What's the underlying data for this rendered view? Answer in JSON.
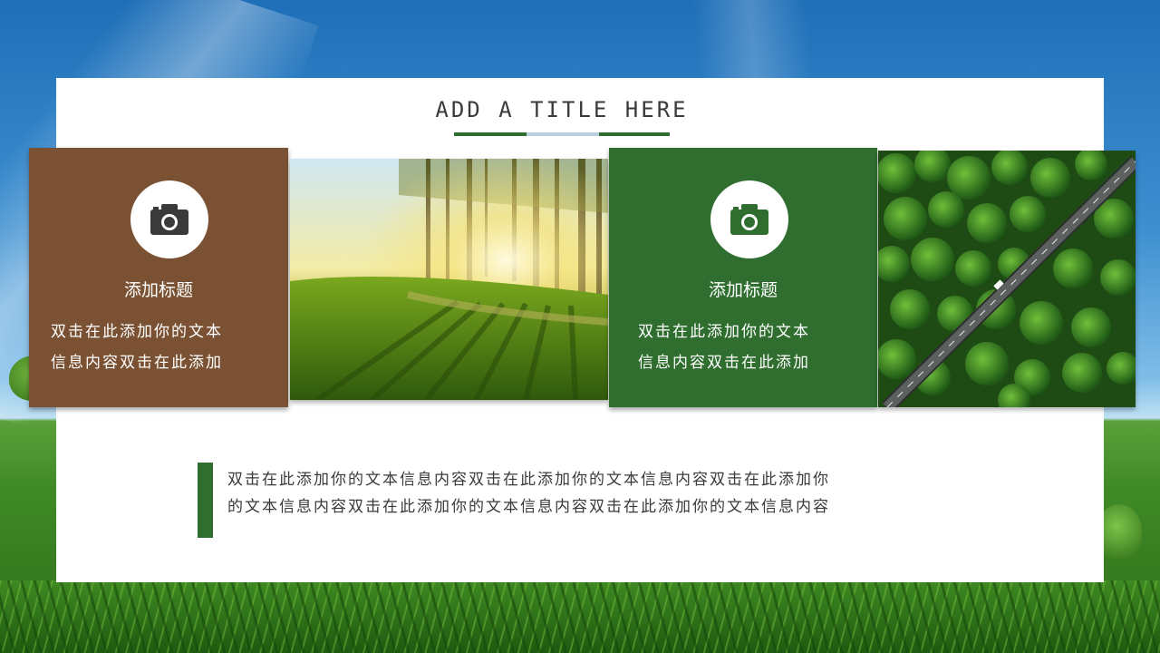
{
  "slide": {
    "title": "ADD A TITLE HERE",
    "colors": {
      "brown": "#7a5233",
      "green": "#2f6e2f",
      "title_bar_light": "#b8cfdc"
    },
    "cards": [
      {
        "icon": "camera-icon",
        "title": "添加标题",
        "body_line1": "双击在此添加你的文本",
        "body_line2": "信息内容双击在此添加"
      },
      {
        "icon": "camera-icon",
        "title": "添加标题",
        "body_line1": "双击在此添加你的文本",
        "body_line2": "信息内容双击在此添加"
      }
    ],
    "photos": [
      {
        "subject": "sunlit forest"
      },
      {
        "subject": "aerial road through forest"
      }
    ],
    "footer": {
      "line1": "双击在此添加你的文本信息内容双击在此添加你的文本信息内容双击在此添加你",
      "line2": "的文本信息内容双击在此添加你的文本信息内容双击在此添加你的文本信息内容"
    }
  }
}
